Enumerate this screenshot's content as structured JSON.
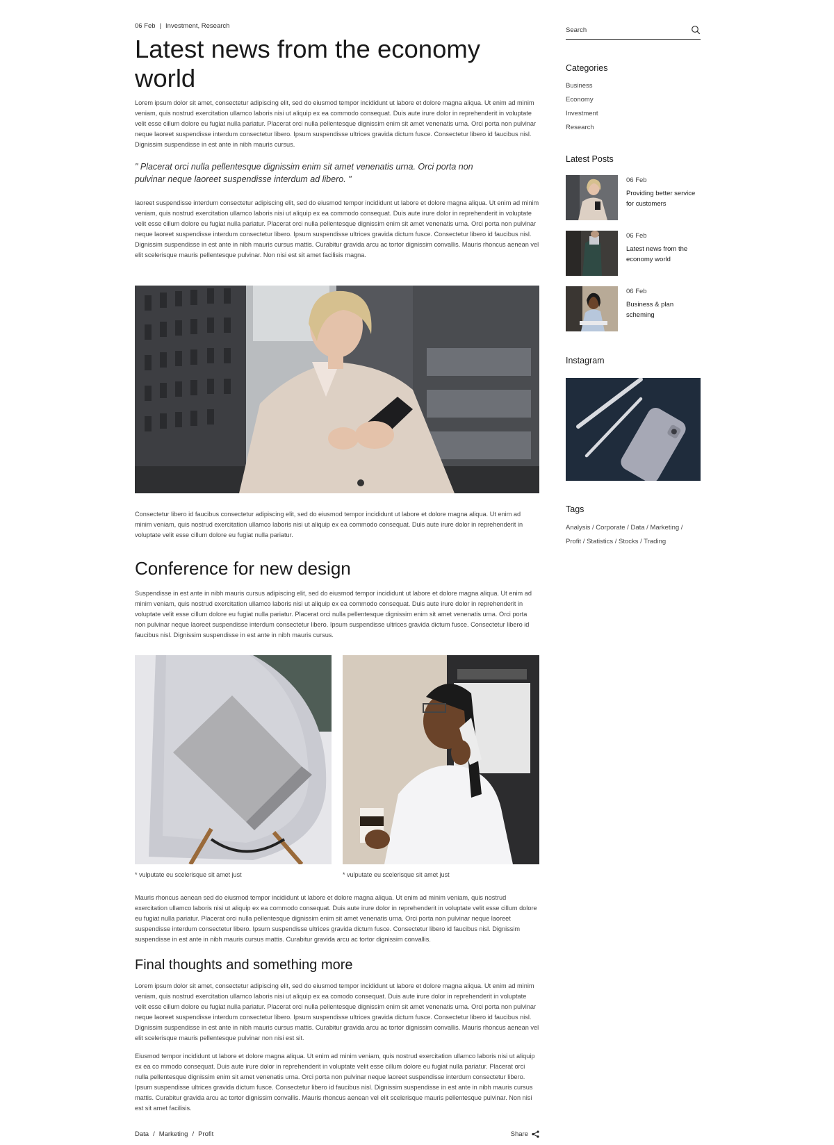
{
  "post": {
    "date": "06 Feb",
    "separator": "|",
    "categories": "Investment, Research",
    "title": "Latest news from the economy world",
    "p1": "Lorem ipsum dolor sit amet, consectetur adipiscing elit, sed do eiusmod tempor incididunt ut labore et dolore magna aliqua. Ut enim ad minim veniam, quis nostrud exercitation ullamco laboris nisi ut aliquip ex ea commodo consequat. Duis aute irure dolor in reprehenderit in voluptate velit esse cillum dolore eu fugiat nulla pariatur. Placerat orci nulla pellentesque dignissim enim sit amet venenatis urna. Orci porta non pulvinar neque laoreet suspendisse interdum consectetur libero. Ipsum suspendisse ultrices gravida dictum fusce. Consectetur libero id faucibus nisl. Dignissim suspendisse in est ante in nibh mauris cursus.",
    "quote": "\" Placerat orci nulla pellentesque dignissim enim sit amet venenatis urna. Orci porta non pulvinar neque laoreet suspendisse interdum ad libero. \"",
    "p2": "laoreet suspendisse interdum consectetur adipiscing elit, sed do eiusmod tempor incididunt ut labore et dolore magna aliqua. Ut enim ad minim veniam, quis nostrud exercitation ullamco laboris nisi ut aliquip ex ea commodo consequat. Duis aute irure dolor in reprehenderit in voluptate velit esse cillum dolore eu fugiat nulla pariatur. Placerat orci nulla pellentesque dignissim enim sit amet venenatis urna. Orci porta non pulvinar neque laoreet suspendisse interdum consectetur libero. Ipsum suspendisse ultrices gravida dictum fusce. Consectetur libero id faucibus nisl. Dignissim suspendisse in est ante in nibh mauris cursus mattis. Curabitur gravida arcu ac tortor dignissim convallis. Mauris rhoncus aenean vel elit scelerisque mauris pellentesque pulvinar. Non nisi est sit amet facilisis magna.",
    "p3": "Consectetur libero id faucibus consectetur adipiscing elit, sed do eiusmod tempor incididunt ut labore et dolore magna aliqua. Ut enim ad minim veniam, quis nostrud exercitation ullamco laboris nisi ut aliquip ex ea commodo consequat. Duis aute irure dolor in reprehenderit in voluptate velit esse cillum dolore eu fugiat nulla pariatur.",
    "h2_conference": "Conference for new design",
    "p4": "Suspendisse in est ante in nibh mauris cursus adipiscing elit, sed do eiusmod tempor incididunt ut labore et dolore magna aliqua. Ut enim ad minim veniam, quis nostrud exercitation ullamco laboris nisi ut aliquip ex ea commodo consequat. Duis aute irure dolor in reprehenderit in voluptate velit esse cillum dolore eu fugiat nulla pariatur. Placerat orci nulla pellentesque dignissim enim sit amet venenatis urna. Orci porta non pulvinar neque laoreet suspendisse interdum consectetur libero. Ipsum suspendisse ultrices gravida dictum fusce. Consectetur libero id faucibus nisl. Dignissim suspendisse in est ante in nibh mauris cursus.",
    "caption1": "* vulputate eu scelerisque sit amet just",
    "caption2": "* vulputate eu scelerisque sit amet just",
    "p5": "Mauris rhoncus aenean sed do eiusmod tempor incididunt ut labore et dolore magna aliqua. Ut enim ad minim veniam, quis nostrud exercitation ullamco laboris nisi ut aliquip ex ea commodo consequat. Duis aute irure dolor in reprehenderit in voluptate velit esse cillum dolore eu fugiat nulla pariatur. Placerat orci nulla pellentesque dignissim enim sit amet venenatis urna. Orci porta non pulvinar neque laoreet suspendisse interdum consectetur libero. Ipsum suspendisse ultrices gravida dictum fusce. Consectetur libero id faucibus nisl. Dignissim suspendisse in est ante in nibh mauris cursus mattis. Curabitur gravida arcu ac tortor dignissim convallis.",
    "h2_final": "Final thoughts and something more",
    "p6": "Lorem ipsum dolor sit amet, consectetur adipiscing elit, sed do eiusmod tempor incididunt ut labore et dolore magna aliqua. Ut enim ad minim veniam, quis nostrud exercitation ullamco laboris nisi ut aliquip ex ea comodo consequat. Duis aute irure dolor in reprehenderit in voluptate velit esse cillum dolore eu fugiat nulla pariatur. Placerat orci nulla pellentesque dignissim enim sit amet venenatis urna. Orci porta non pulvinar neque laoreet suspendisse interdum consectetur libero. Ipsum suspendisse ultrices gravida dictum fusce. Consectetur libero id faucibus nisl. Dignissim suspendisse in est ante in nibh mauris cursus mattis. Curabitur gravida arcu ac tortor dignissim convallis. Mauris rhoncus aenean vel elit scelerisque mauris pellentesque pulvinar non nisi est sit.",
    "p7": "Eiusmod tempor incididunt ut labore et dolore magna aliqua. Ut enim ad minim veniam, quis nostrud exercitation ullamco laboris nisi ut aliquip ex ea co mmodo consequat. Duis aute irure dolor in reprehenderit in voluptate velit esse cillum dolore eu fugiat nulla pariatur. Placerat orci nulla pellentesque dignissim enim sit amet venenatis urna. Orci porta non pulvinar neque laoreet suspendisse interdum consectetur libero. Ipsum suspendisse ultrices gravida dictum fusce. Consectetur libero id faucibus nisl. Dignissim suspendisse in est ante in nibh mauris cursus mattis. Curabitur gravida arcu ac tortor dignissim convallis. Mauris rhoncus aenean vel elit scelerisque mauris pellentesque pulvinar. Non nisi est sit amet facilisis.",
    "footer_tags": [
      "Data",
      "Marketing",
      "Profit"
    ],
    "footer_sep": "/",
    "share_label": "Share"
  },
  "sidebar": {
    "search_placeholder": "Search",
    "categories_title": "Categories",
    "categories": [
      "Business",
      "Economy",
      "Investment",
      "Research"
    ],
    "latest_title": "Latest Posts",
    "latest": [
      {
        "date": "06 Feb",
        "title": "Providing better service for customers"
      },
      {
        "date": "06 Feb",
        "title": "Latest news from the economy world"
      },
      {
        "date": "06 Feb",
        "title": "Business & plan scheming"
      }
    ],
    "instagram_title": "Instagram",
    "tags_title": "Tags",
    "tags_line1": "Analysis / Corporate / Data / Marketing /",
    "tags_line2": "Profit / Statistics / Stocks / Trading"
  }
}
